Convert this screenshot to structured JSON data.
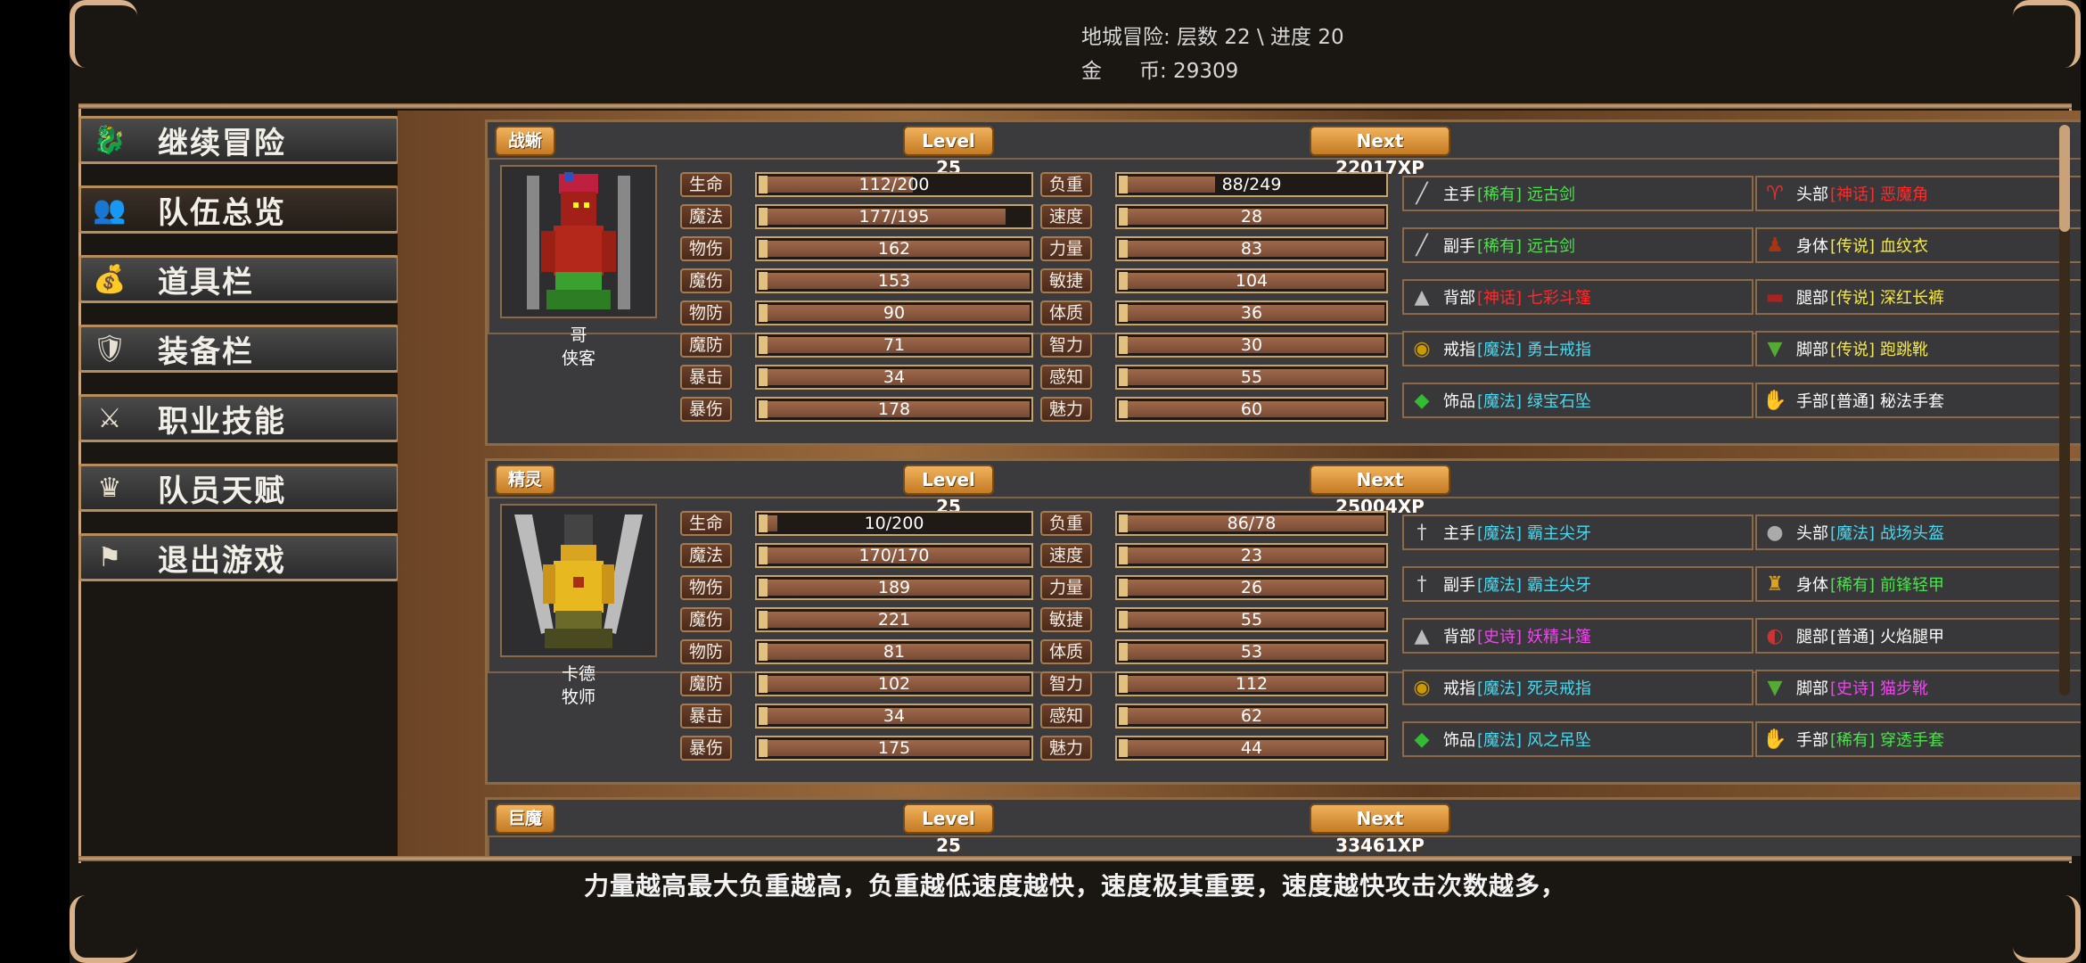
{
  "header": {
    "dungeon_line": "地城冒险: 层数 22 \\ 进度 20",
    "gold_label_a": "金",
    "gold_label_b": "币: 29309"
  },
  "sidebar": {
    "items": [
      {
        "label": "继续冒险",
        "icon": "dragon-icon"
      },
      {
        "label": "队伍总览",
        "icon": "party-icon",
        "active": true
      },
      {
        "label": "道具栏",
        "icon": "bag-icon"
      },
      {
        "label": "装备栏",
        "icon": "sword-shield-icon"
      },
      {
        "label": "职业技能",
        "icon": "winged-sword-icon"
      },
      {
        "label": "队员天赋",
        "icon": "laurel-crown-icon"
      },
      {
        "label": "退出游戏",
        "icon": "flag-icon"
      }
    ]
  },
  "colors": {
    "rare": "#4ee34e",
    "legendary": "#f4e84a",
    "magic": "#4ad8f0",
    "epic": "#e84ae8",
    "common": "#ffffff",
    "mythic": "#ff2a2a"
  },
  "labels": {
    "hp": "生命",
    "mp": "魔法",
    "patk": "物伤",
    "matk": "魔伤",
    "pdef": "物防",
    "mdef": "魔防",
    "crit": "暴击",
    "critdmg": "暴伤",
    "load": "负重",
    "speed": "速度",
    "str": "力量",
    "agi": "敏捷",
    "con": "体质",
    "int": "智力",
    "per": "感知",
    "cha": "魅力"
  },
  "members": [
    {
      "class_tag": "战蜥",
      "level": "Level 25",
      "next": "Next 22017XP",
      "name": "哥",
      "role": "侠客",
      "left_stats": [
        "112/200",
        "177/195",
        "162",
        "153",
        "90",
        "71",
        "34",
        "178"
      ],
      "left_fill": [
        0.56,
        0.91,
        1,
        1,
        1,
        1,
        1,
        1
      ],
      "right_stats": [
        "88/249",
        "28",
        "83",
        "104",
        "36",
        "30",
        "55",
        "60"
      ],
      "right_fill": [
        0.35,
        1,
        1,
        1,
        1,
        1,
        1,
        1
      ],
      "equipment": [
        {
          "slot": "主手",
          "rarity": "[稀有]",
          "rarity_key": "rare",
          "item": "远古剑",
          "icon": "sword-icon"
        },
        {
          "slot": "头部",
          "rarity": "[神话]",
          "rarity_key": "mythic",
          "item": "恶魔角",
          "icon": "horned-helm-icon"
        },
        {
          "slot": "副手",
          "rarity": "[稀有]",
          "rarity_key": "rare",
          "item": "远古剑",
          "icon": "sword-icon"
        },
        {
          "slot": "身体",
          "rarity": "[传说]",
          "rarity_key": "legendary",
          "item": "血纹衣",
          "icon": "robe-icon"
        },
        {
          "slot": "背部",
          "rarity": "[神话]",
          "rarity_key": "mythic",
          "item": "七彩斗篷",
          "icon": "cloak-icon"
        },
        {
          "slot": "腿部",
          "rarity": "[传说]",
          "rarity_key": "legendary",
          "item": "深红长裤",
          "icon": "pants-icon"
        },
        {
          "slot": "戒指",
          "rarity": "[魔法]",
          "rarity_key": "magic",
          "item": "勇士戒指",
          "icon": "ring-icon"
        },
        {
          "slot": "脚部",
          "rarity": "[传说]",
          "rarity_key": "legendary",
          "item": "跑跳靴",
          "icon": "boots-icon"
        },
        {
          "slot": "饰品",
          "rarity": "[魔法]",
          "rarity_key": "magic",
          "item": "绿宝石坠",
          "icon": "amulet-icon"
        },
        {
          "slot": "手部",
          "rarity": "[普通]",
          "rarity_key": "common",
          "item": "秘法手套",
          "icon": "gauntlet-icon"
        }
      ]
    },
    {
      "class_tag": "精灵",
      "level": "Level 25",
      "next": "Next 25004XP",
      "name": "卡德",
      "role": "牧师",
      "left_stats": [
        "10/200",
        "170/170",
        "189",
        "221",
        "81",
        "102",
        "34",
        "175"
      ],
      "left_fill": [
        0.05,
        1,
        1,
        1,
        1,
        1,
        1,
        1
      ],
      "right_stats": [
        "86/78",
        "23",
        "26",
        "55",
        "53",
        "112",
        "62",
        "44"
      ],
      "right_fill": [
        1,
        1,
        1,
        1,
        1,
        1,
        1,
        1
      ],
      "equipment": [
        {
          "slot": "主手",
          "rarity": "[魔法]",
          "rarity_key": "magic",
          "item": "霸主尖牙",
          "icon": "dagger-icon"
        },
        {
          "slot": "头部",
          "rarity": "[魔法]",
          "rarity_key": "magic",
          "item": "战场头盔",
          "icon": "helmet-icon"
        },
        {
          "slot": "副手",
          "rarity": "[魔法]",
          "rarity_key": "magic",
          "item": "霸主尖牙",
          "icon": "dagger-icon"
        },
        {
          "slot": "身体",
          "rarity": "[稀有]",
          "rarity_key": "rare",
          "item": "前锋轻甲",
          "icon": "armor-icon"
        },
        {
          "slot": "背部",
          "rarity": "[史诗]",
          "rarity_key": "epic",
          "item": "妖精斗篷",
          "icon": "cloak-icon"
        },
        {
          "slot": "腿部",
          "rarity": "[普通]",
          "rarity_key": "common",
          "item": "火焰腿甲",
          "icon": "leg-armor-icon"
        },
        {
          "slot": "戒指",
          "rarity": "[魔法]",
          "rarity_key": "magic",
          "item": "死灵戒指",
          "icon": "ring-icon"
        },
        {
          "slot": "脚部",
          "rarity": "[史诗]",
          "rarity_key": "epic",
          "item": "猫步靴",
          "icon": "boots-icon"
        },
        {
          "slot": "饰品",
          "rarity": "[魔法]",
          "rarity_key": "magic",
          "item": "风之吊坠",
          "icon": "amulet-icon"
        },
        {
          "slot": "手部",
          "rarity": "[稀有]",
          "rarity_key": "rare",
          "item": "穿透手套",
          "icon": "gauntlet-icon"
        }
      ]
    },
    {
      "class_tag": "巨魔",
      "level": "Level 25",
      "next": "Next 33461XP"
    }
  ],
  "footer": {
    "tip": "力量越高最大负重越高，负重越低速度越快，速度极其重要，速度越快攻击次数越多，"
  }
}
